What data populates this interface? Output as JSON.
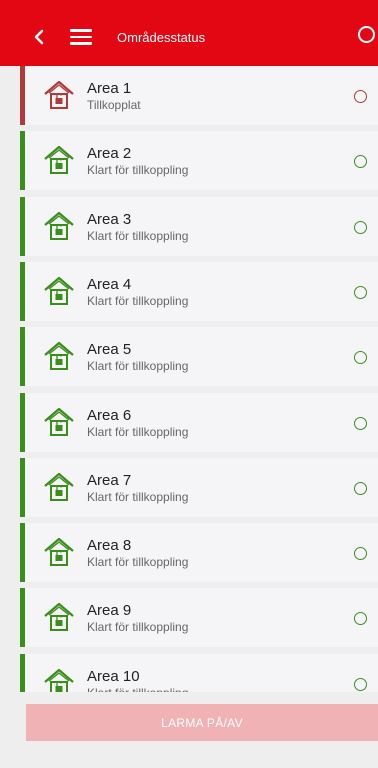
{
  "header": {
    "title": "Områdesstatus",
    "back_icon": "chevron-left-icon",
    "menu_icon": "hamburger-menu-icon",
    "status_icon": "circle-icon"
  },
  "colors": {
    "brand": "#e30613",
    "armed": "#b03a3a",
    "ready": "#3a8f1a",
    "button_disabled": "#f0b2b5"
  },
  "areas": [
    {
      "name": "Area 1",
      "status": "Tillkopplat",
      "state": "armed"
    },
    {
      "name": "Area 2",
      "status": "Klart för tillkoppling",
      "state": "ready"
    },
    {
      "name": "Area 3",
      "status": "Klart för tillkoppling",
      "state": "ready"
    },
    {
      "name": "Area 4",
      "status": "Klart för tillkoppling",
      "state": "ready"
    },
    {
      "name": "Area 5",
      "status": "Klart för tillkoppling",
      "state": "ready"
    },
    {
      "name": "Area 6",
      "status": "Klart för tillkoppling",
      "state": "ready"
    },
    {
      "name": "Area 7",
      "status": "Klart för tillkoppling",
      "state": "ready"
    },
    {
      "name": "Area 8",
      "status": "Klart för tillkoppling",
      "state": "ready"
    },
    {
      "name": "Area 9",
      "status": "Klart för tillkoppling",
      "state": "ready"
    },
    {
      "name": "Area 10",
      "status": "Klart för tillkoppling",
      "state": "ready"
    }
  ],
  "footer": {
    "button_label": "LARMA PÅ/AV"
  }
}
